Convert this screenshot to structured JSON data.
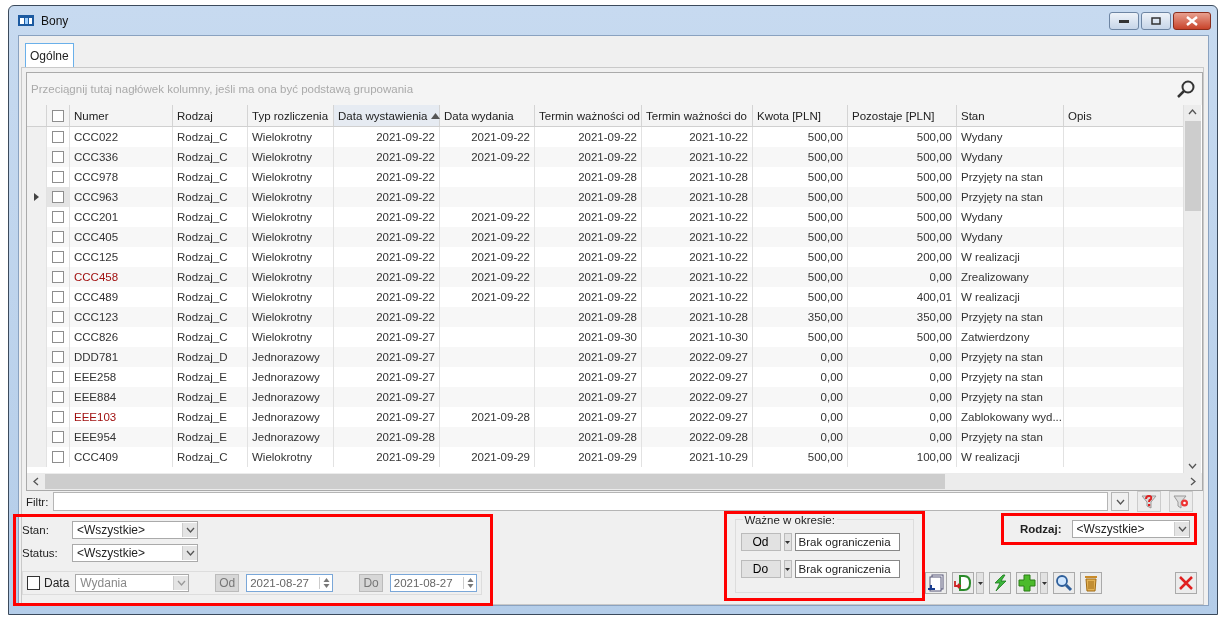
{
  "window": {
    "title": "Bony"
  },
  "tabs": [
    {
      "label": "Ogólne",
      "selected": true
    }
  ],
  "grid": {
    "group_hint": "Przeciągnij tutaj nagłówek kolumny, jeśli ma ona być podstawą grupowania",
    "select_all_checked": false,
    "columns": [
      {
        "label": "Numer",
        "sorted": false
      },
      {
        "label": "Rodzaj",
        "sorted": false
      },
      {
        "label": "Typ rozliczenia",
        "sorted": false
      },
      {
        "label": "Data wystawienia",
        "sorted": true
      },
      {
        "label": "Data wydania",
        "sorted": false
      },
      {
        "label": "Termin ważności od",
        "sorted": false
      },
      {
        "label": "Termin ważności do",
        "sorted": false
      },
      {
        "label": "Kwota [PLN]",
        "sorted": false
      },
      {
        "label": "Pozostaje [PLN]",
        "sorted": false
      },
      {
        "label": "Stan",
        "sorted": false
      },
      {
        "label": "Opis",
        "sorted": false
      }
    ],
    "rows": [
      {
        "checked": false,
        "current": false,
        "flagged": false,
        "numer": "CCC022",
        "rodzaj": "Rodzaj_C",
        "typ": "Wielokrotny",
        "data_wystawienia": "2021-09-22",
        "data_wydania": "2021-09-22",
        "termin_od": "2021-09-22",
        "termin_do": "2021-10-22",
        "kwota": "500,00",
        "pozostaje": "500,00",
        "stan": "Wydany"
      },
      {
        "checked": false,
        "current": false,
        "flagged": false,
        "numer": "CCC336",
        "rodzaj": "Rodzaj_C",
        "typ": "Wielokrotny",
        "data_wystawienia": "2021-09-22",
        "data_wydania": "2021-09-22",
        "termin_od": "2021-09-22",
        "termin_do": "2021-10-22",
        "kwota": "500,00",
        "pozostaje": "500,00",
        "stan": "Wydany"
      },
      {
        "checked": false,
        "current": false,
        "flagged": false,
        "numer": "CCC978",
        "rodzaj": "Rodzaj_C",
        "typ": "Wielokrotny",
        "data_wystawienia": "2021-09-22",
        "termin_od": "2021-09-28",
        "termin_do": "2021-10-28",
        "kwota": "500,00",
        "pozostaje": "500,00",
        "stan": "Przyjęty na stan"
      },
      {
        "checked": false,
        "current": true,
        "flagged": false,
        "numer": "CCC963",
        "rodzaj": "Rodzaj_C",
        "typ": "Wielokrotny",
        "data_wystawienia": "2021-09-22",
        "termin_od": "2021-09-28",
        "termin_do": "2021-10-28",
        "kwota": "500,00",
        "pozostaje": "500,00",
        "stan": "Przyjęty na stan"
      },
      {
        "checked": false,
        "current": false,
        "flagged": false,
        "numer": "CCC201",
        "rodzaj": "Rodzaj_C",
        "typ": "Wielokrotny",
        "data_wystawienia": "2021-09-22",
        "data_wydania": "2021-09-22",
        "termin_od": "2021-09-22",
        "termin_do": "2021-10-22",
        "kwota": "500,00",
        "pozostaje": "500,00",
        "stan": "Wydany"
      },
      {
        "checked": false,
        "current": false,
        "flagged": false,
        "numer": "CCC405",
        "rodzaj": "Rodzaj_C",
        "typ": "Wielokrotny",
        "data_wystawienia": "2021-09-22",
        "data_wydania": "2021-09-22",
        "termin_od": "2021-09-22",
        "termin_do": "2021-10-22",
        "kwota": "500,00",
        "pozostaje": "500,00",
        "stan": "Wydany"
      },
      {
        "checked": false,
        "current": false,
        "flagged": false,
        "numer": "CCC125",
        "rodzaj": "Rodzaj_C",
        "typ": "Wielokrotny",
        "data_wystawienia": "2021-09-22",
        "data_wydania": "2021-09-22",
        "termin_od": "2021-09-22",
        "termin_do": "2021-10-22",
        "kwota": "500,00",
        "pozostaje": "200,00",
        "stan": "W realizacji"
      },
      {
        "checked": false,
        "current": false,
        "flagged": true,
        "numer": "CCC458",
        "rodzaj": "Rodzaj_C",
        "typ": "Wielokrotny",
        "data_wystawienia": "2021-09-22",
        "data_wydania": "2021-09-22",
        "termin_od": "2021-09-22",
        "termin_do": "2021-10-22",
        "kwota": "500,00",
        "pozostaje": "0,00",
        "stan": "Zrealizowany"
      },
      {
        "checked": false,
        "current": false,
        "flagged": false,
        "numer": "CCC489",
        "rodzaj": "Rodzaj_C",
        "typ": "Wielokrotny",
        "data_wystawienia": "2021-09-22",
        "data_wydania": "2021-09-22",
        "termin_od": "2021-09-22",
        "termin_do": "2021-10-22",
        "kwota": "500,00",
        "pozostaje": "400,01",
        "stan": "W realizacji"
      },
      {
        "checked": false,
        "current": false,
        "flagged": false,
        "numer": "CCC123",
        "rodzaj": "Rodzaj_C",
        "typ": "Wielokrotny",
        "data_wystawienia": "2021-09-22",
        "termin_od": "2021-09-28",
        "termin_do": "2021-10-28",
        "kwota": "350,00",
        "pozostaje": "350,00",
        "stan": "Przyjęty na stan"
      },
      {
        "checked": false,
        "current": false,
        "flagged": false,
        "numer": "CCC826",
        "rodzaj": "Rodzaj_C",
        "typ": "Wielokrotny",
        "data_wystawienia": "2021-09-27",
        "termin_od": "2021-09-30",
        "termin_do": "2021-10-30",
        "kwota": "500,00",
        "pozostaje": "500,00",
        "stan": "Zatwierdzony"
      },
      {
        "checked": false,
        "current": false,
        "flagged": false,
        "numer": "DDD781",
        "rodzaj": "Rodzaj_D",
        "typ": "Jednorazowy",
        "data_wystawienia": "2021-09-27",
        "termin_od": "2021-09-27",
        "termin_do": "2022-09-27",
        "kwota": "0,00",
        "pozostaje": "0,00",
        "stan": "Przyjęty na stan"
      },
      {
        "checked": false,
        "current": false,
        "flagged": false,
        "numer": "EEE258",
        "rodzaj": "Rodzaj_E",
        "typ": "Jednorazowy",
        "data_wystawienia": "2021-09-27",
        "termin_od": "2021-09-27",
        "termin_do": "2022-09-27",
        "kwota": "0,00",
        "pozostaje": "0,00",
        "stan": "Przyjęty na stan"
      },
      {
        "checked": false,
        "current": false,
        "flagged": false,
        "numer": "EEE884",
        "rodzaj": "Rodzaj_E",
        "typ": "Jednorazowy",
        "data_wystawienia": "2021-09-27",
        "termin_od": "2021-09-27",
        "termin_do": "2022-09-27",
        "kwota": "0,00",
        "pozostaje": "0,00",
        "stan": "Przyjęty na stan"
      },
      {
        "checked": false,
        "current": false,
        "flagged": true,
        "numer": "EEE103",
        "rodzaj": "Rodzaj_E",
        "typ": "Jednorazowy",
        "data_wystawienia": "2021-09-27",
        "data_wydania": "2021-09-28",
        "termin_od": "2021-09-27",
        "termin_do": "2022-09-27",
        "kwota": "0,00",
        "pozostaje": "0,00",
        "stan": "Zablokowany wyd..."
      },
      {
        "checked": false,
        "current": false,
        "flagged": false,
        "numer": "EEE954",
        "rodzaj": "Rodzaj_E",
        "typ": "Jednorazowy",
        "data_wystawienia": "2021-09-28",
        "termin_od": "2021-09-28",
        "termin_do": "2022-09-28",
        "kwota": "0,00",
        "pozostaje": "0,00",
        "stan": "Przyjęty na stan"
      },
      {
        "checked": false,
        "current": false,
        "flagged": false,
        "numer": "CCC409",
        "rodzaj": "Rodzaj_C",
        "typ": "Wielokrotny",
        "data_wystawienia": "2021-09-29",
        "data_wydania": "2021-09-29",
        "termin_od": "2021-09-29",
        "termin_do": "2021-10-29",
        "kwota": "500,00",
        "pozostaje": "100,00",
        "stan": "W realizacji"
      }
    ]
  },
  "filter": {
    "label": "Filtr:"
  },
  "filters": {
    "stan": {
      "label": "Stan:",
      "value": "<Wszystkie>"
    },
    "status": {
      "label": "Status:",
      "value": "<Wszystkie>"
    },
    "date": {
      "label": "Data",
      "checked": false,
      "type_value": "Wydania",
      "from_label": "Od",
      "from_value": "2021-08-27",
      "to_label": "Do",
      "to_value": "2021-08-27"
    }
  },
  "period": {
    "title": "Ważne w okresie:",
    "rows": [
      {
        "button": "Od",
        "value": "Brak ograniczenia"
      },
      {
        "button": "Do",
        "value": "Brak ograniczenia"
      }
    ]
  },
  "rodzaj": {
    "label": "Rodzaj:",
    "value": "<Wszystkie>"
  }
}
